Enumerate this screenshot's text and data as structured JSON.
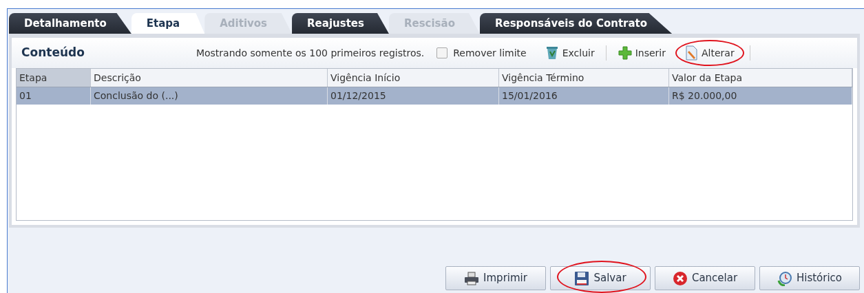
{
  "tabs": [
    {
      "label": "Detalhamento",
      "selected": false,
      "disabled": false
    },
    {
      "label": "Etapa",
      "selected": true,
      "disabled": false
    },
    {
      "label": "Aditivos",
      "selected": false,
      "disabled": true
    },
    {
      "label": "Reajustes",
      "selected": false,
      "disabled": false
    },
    {
      "label": "Rescisão",
      "selected": false,
      "disabled": true
    },
    {
      "label": "Responsáveis do Contrato",
      "selected": false,
      "disabled": false
    }
  ],
  "panel": {
    "title": "Conteúdo",
    "notice": "Mostrando somente os 100 primeiros registros.",
    "remove_limit": {
      "label": "Remover limite",
      "checked": false
    },
    "toolbar": [
      {
        "kind": "delete",
        "label": "Excluir",
        "circled": false
      },
      {
        "kind": "insert",
        "label": "Inserir",
        "circled": false
      },
      {
        "kind": "edit",
        "label": "Alterar",
        "circled": true
      }
    ]
  },
  "table": {
    "columns": [
      "Etapa",
      "Descrição",
      "Vigência Início",
      "Vigência Término",
      "Valor da Etapa"
    ],
    "rows": [
      {
        "selected": true,
        "cells": [
          "01",
          "Conclusão do (...)",
          "01/12/2015",
          "15/01/2016",
          "R$ 20.000,00"
        ]
      }
    ]
  },
  "buttons": [
    {
      "kind": "print",
      "label": "Imprimir",
      "circled": false
    },
    {
      "kind": "save",
      "label": "Salvar",
      "circled": true
    },
    {
      "kind": "cancel",
      "label": "Cancelar",
      "circled": false
    },
    {
      "kind": "history",
      "label": "Histórico",
      "circled": false
    }
  ]
}
